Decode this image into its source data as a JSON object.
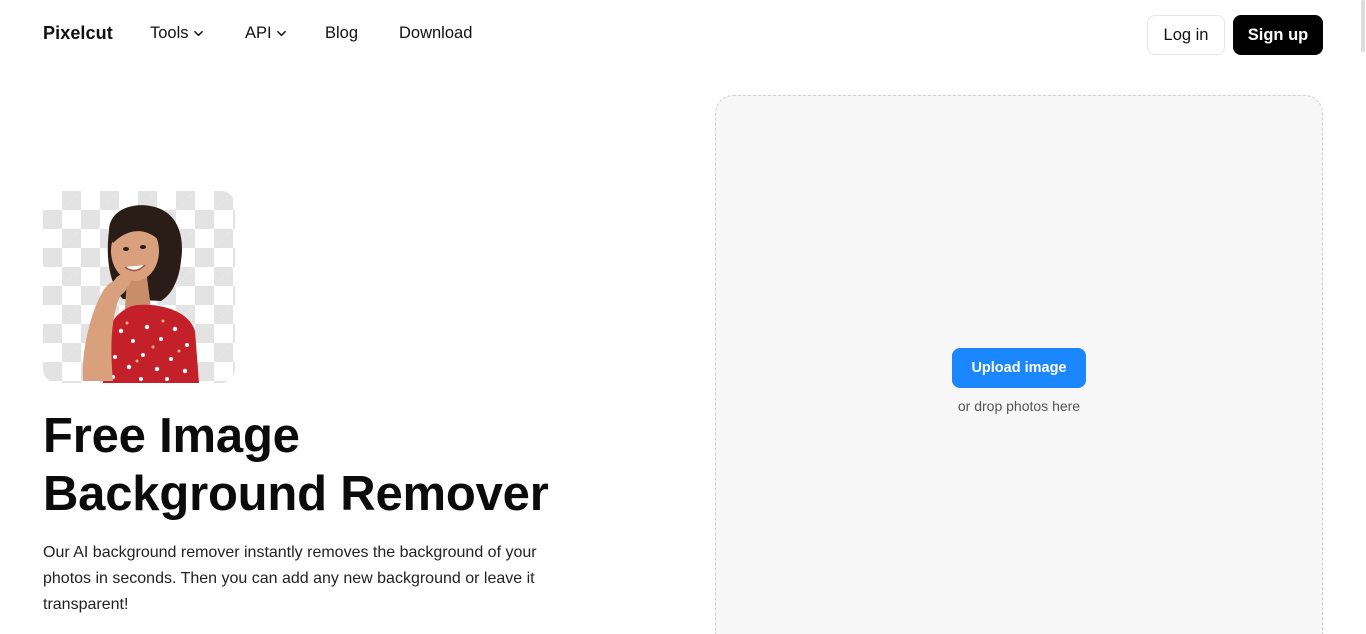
{
  "nav": {
    "logo": "Pixelcut",
    "links": [
      {
        "label": "Tools",
        "has_dropdown": true
      },
      {
        "label": "API",
        "has_dropdown": true
      },
      {
        "label": "Blog",
        "has_dropdown": false
      },
      {
        "label": "Download",
        "has_dropdown": false
      }
    ],
    "login_label": "Log in",
    "signup_label": "Sign up"
  },
  "hero": {
    "title_line1": "Free Image",
    "title_line2": "Background Remover",
    "description": "Our AI background remover instantly removes the background of your photos in seconds. Then you can add any new background or leave it transparent!"
  },
  "dropzone": {
    "upload_label": "Upload image",
    "hint": "or drop photos here"
  },
  "colors": {
    "upload_button": "#1a87ff",
    "signup_button": "#000000",
    "dropzone_bg": "#f7f7f7"
  }
}
